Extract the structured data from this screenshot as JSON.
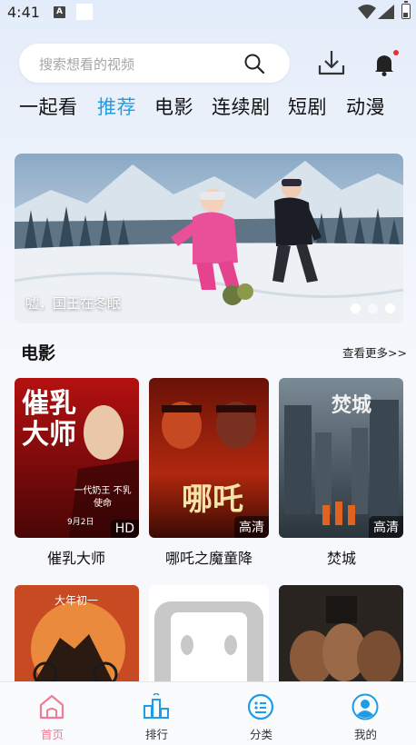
{
  "status_bar": {
    "time": "4:41",
    "notification_letter": "A"
  },
  "search": {
    "placeholder": "搜索想看的视频"
  },
  "tabs": [
    {
      "label": "一起看",
      "active": false
    },
    {
      "label": "推荐",
      "active": true
    },
    {
      "label": "电影",
      "active": false
    },
    {
      "label": "连续剧",
      "active": false
    },
    {
      "label": "短剧",
      "active": false
    },
    {
      "label": "动漫",
      "active": false
    }
  ],
  "banner": {
    "caption": "嘘，国王在冬眠",
    "slide_count": 3,
    "active_slide": 1
  },
  "section": {
    "title": "电影",
    "more_label": "查看更多>>"
  },
  "movies": [
    {
      "title": "催乳大师",
      "badge": "HD",
      "poster_text": "催乳大师",
      "tagline": "一代奶王 不乳使命",
      "date": "9月2日"
    },
    {
      "title": "哪吒之魔童降",
      "badge": "高清",
      "poster_text": "哪吒"
    },
    {
      "title": "焚城",
      "badge": "高清",
      "poster_text": "焚城"
    }
  ],
  "movies_row2": [
    {
      "poster_text": "大年初一"
    },
    {
      "poster_text": ""
    },
    {
      "poster_text": ""
    }
  ],
  "bottom_nav": [
    {
      "label": "首页",
      "icon": "home-icon",
      "active": true
    },
    {
      "label": "排行",
      "icon": "ranking-icon",
      "active": false
    },
    {
      "label": "分类",
      "icon": "category-icon",
      "active": false
    },
    {
      "label": "我的",
      "icon": "profile-icon",
      "active": false
    }
  ],
  "colors": {
    "accent": "#1e9de6",
    "nav_active": "#f07b96",
    "badge_dot": "#e8322e",
    "nav_icon": "#1e9de6"
  }
}
